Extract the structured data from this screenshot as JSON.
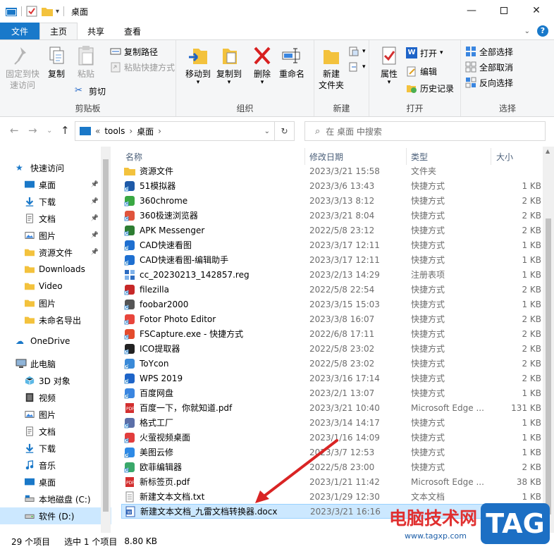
{
  "window": {
    "title": "桌面",
    "minimize_icon": "minimize-icon",
    "maximize_icon": "maximize-icon",
    "close_icon": "close-icon"
  },
  "ribbon_tabs": {
    "file": "文件",
    "home": "主页",
    "share": "共享",
    "view": "查看"
  },
  "ribbon": {
    "clipboard": {
      "label": "剪贴板",
      "pin_quick_line1": "固定到快",
      "pin_quick_line2": "速访问",
      "copy": "复制",
      "paste": "粘贴",
      "copy_path": "复制路径",
      "paste_shortcut": "粘贴快捷方式",
      "cut": "剪切"
    },
    "organize": {
      "label": "组织",
      "move_to": "移动到",
      "copy_to": "复制到",
      "delete": "删除",
      "rename": "重命名"
    },
    "new": {
      "label": "新建",
      "new_folder_line1": "新建",
      "new_folder_line2": "文件夹"
    },
    "open": {
      "label": "打开",
      "properties": "属性",
      "open": "打开",
      "edit": "编辑",
      "history": "历史记录"
    },
    "select": {
      "label": "选择",
      "select_all": "全部选择",
      "select_none": "全部取消",
      "invert": "反向选择"
    }
  },
  "address": {
    "prefix": "«",
    "crumb1": "tools",
    "sep1": "›",
    "crumb2": "桌面",
    "sep2": "›"
  },
  "search": {
    "placeholder": "在 桌面 中搜索"
  },
  "columns": {
    "name": "名称",
    "date": "修改日期",
    "type": "类型",
    "size": "大小"
  },
  "sidebar": {
    "quick_access": "快速访问",
    "items": [
      {
        "label": "桌面",
        "icon": "desktop-icon",
        "pinned": true
      },
      {
        "label": "下载",
        "icon": "download-icon",
        "pinned": true
      },
      {
        "label": "文档",
        "icon": "document-icon",
        "pinned": true
      },
      {
        "label": "图片",
        "icon": "picture-icon",
        "pinned": true
      },
      {
        "label": "资源文件",
        "icon": "folder-icon",
        "pinned": true
      },
      {
        "label": "Downloads",
        "icon": "folder-icon",
        "pinned": false
      },
      {
        "label": "Video",
        "icon": "folder-icon",
        "pinned": false
      },
      {
        "label": "图片",
        "icon": "folder-icon",
        "pinned": false
      },
      {
        "label": "未命名导出",
        "icon": "folder-icon",
        "pinned": false
      }
    ],
    "onedrive": "OneDrive",
    "this_pc": "此电脑",
    "pc_items": [
      {
        "label": "3D 对象",
        "icon": "3d-objects-icon"
      },
      {
        "label": "视频",
        "icon": "video-icon"
      },
      {
        "label": "图片",
        "icon": "picture-icon"
      },
      {
        "label": "文档",
        "icon": "document-icon"
      },
      {
        "label": "下载",
        "icon": "download-icon"
      },
      {
        "label": "音乐",
        "icon": "music-icon"
      },
      {
        "label": "桌面",
        "icon": "desktop-icon"
      },
      {
        "label": "本地磁盘 (C:)",
        "icon": "local-disk-icon"
      },
      {
        "label": "软件 (D:)",
        "icon": "drive-icon"
      }
    ]
  },
  "files": [
    {
      "name": "资源文件",
      "date": "2023/3/21 15:58",
      "type": "文件夹",
      "size": "",
      "color": "#f5c542",
      "icon": "folder-icon"
    },
    {
      "name": "51模拟器",
      "date": "2023/3/6 13:43",
      "type": "快捷方式",
      "size": "1 KB",
      "color": "#1e5aa8",
      "icon": "app-icon"
    },
    {
      "name": "360chrome",
      "date": "2023/3/13 8:12",
      "type": "快捷方式",
      "size": "2 KB",
      "color": "#3aa843",
      "icon": "browser-icon"
    },
    {
      "name": "360极速浏览器",
      "date": "2023/3/21 8:04",
      "type": "快捷方式",
      "size": "2 KB",
      "color": "#e0543c",
      "icon": "browser-icon"
    },
    {
      "name": "APK Messenger",
      "date": "2022/5/8 23:12",
      "type": "快捷方式",
      "size": "2 KB",
      "color": "#2e7d32",
      "icon": "app-icon"
    },
    {
      "name": "CAD快速看图",
      "date": "2023/3/17 12:11",
      "type": "快捷方式",
      "size": "1 KB",
      "color": "#1e6fd0",
      "icon": "app-icon"
    },
    {
      "name": "CAD快速看图-编辑助手",
      "date": "2023/3/17 12:11",
      "type": "快捷方式",
      "size": "1 KB",
      "color": "#1e6fd0",
      "icon": "app-icon"
    },
    {
      "name": "cc_20230213_142857.reg",
      "date": "2023/2/13 14:29",
      "type": "注册表项",
      "size": "1 KB",
      "color": "#2d6cc0",
      "icon": "registry-icon"
    },
    {
      "name": "filezilla",
      "date": "2022/5/8 22:54",
      "type": "快捷方式",
      "size": "2 KB",
      "color": "#c62828",
      "icon": "app-icon"
    },
    {
      "name": "foobar2000",
      "date": "2023/3/15 15:03",
      "type": "快捷方式",
      "size": "1 KB",
      "color": "#555555",
      "icon": "app-icon"
    },
    {
      "name": "Fotor Photo Editor",
      "date": "2023/3/8 16:07",
      "type": "快捷方式",
      "size": "2 KB",
      "color": "#e8453c",
      "icon": "app-icon"
    },
    {
      "name": "FSCapture.exe - 快捷方式",
      "date": "2022/6/8 17:11",
      "type": "快捷方式",
      "size": "2 KB",
      "color": "#e44b2c",
      "icon": "app-icon"
    },
    {
      "name": "ICO提取器",
      "date": "2022/5/8 23:02",
      "type": "快捷方式",
      "size": "2 KB",
      "color": "#222222",
      "icon": "app-icon"
    },
    {
      "name": "ToYcon",
      "date": "2022/5/8 23:02",
      "type": "快捷方式",
      "size": "2 KB",
      "color": "#3a8ad8",
      "icon": "app-icon"
    },
    {
      "name": "WPS 2019",
      "date": "2023/3/16 17:14",
      "type": "快捷方式",
      "size": "2 KB",
      "color": "#1e64c8",
      "icon": "app-icon"
    },
    {
      "name": "百度网盘",
      "date": "2023/2/1 13:07",
      "type": "快捷方式",
      "size": "1 KB",
      "color": "#3a86e0",
      "icon": "app-icon"
    },
    {
      "name": "百度一下，你就知道.pdf",
      "date": "2023/3/21 10:40",
      "type": "Microsoft Edge ...",
      "size": "131 KB",
      "color": "#d32f2f",
      "icon": "pdf-icon"
    },
    {
      "name": "格式工厂",
      "date": "2023/3/14 14:17",
      "type": "快捷方式",
      "size": "1 KB",
      "color": "#5b6fa8",
      "icon": "app-icon"
    },
    {
      "name": "火萤视频桌面",
      "date": "2023/1/16 14:09",
      "type": "快捷方式",
      "size": "1 KB",
      "color": "#e23d3d",
      "icon": "app-icon"
    },
    {
      "name": "美图云修",
      "date": "2023/3/7 12:53",
      "type": "快捷方式",
      "size": "1 KB",
      "color": "#2e8ae6",
      "icon": "app-icon"
    },
    {
      "name": "欧菲编辑器",
      "date": "2022/5/8 23:00",
      "type": "快捷方式",
      "size": "2 KB",
      "color": "#3aa86a",
      "icon": "app-icon"
    },
    {
      "name": "新标签页.pdf",
      "date": "2023/1/21 11:42",
      "type": "Microsoft Edge ...",
      "size": "38 KB",
      "color": "#d32f2f",
      "icon": "pdf-icon"
    },
    {
      "name": "新建文本文档.txt",
      "date": "2023/1/29 12:30",
      "type": "文本文档",
      "size": "1 KB",
      "color": "#9e9e9e",
      "icon": "text-file-icon"
    },
    {
      "name": "新建文本文档_九雷文档转换器.docx",
      "date": "2023/3/21 16:16",
      "type": "",
      "size": "",
      "color": "#2b5fb4",
      "icon": "word-doc-icon",
      "selected": true
    }
  ],
  "status": {
    "count": "29 个项目",
    "selected": "选中 1 个项目",
    "size": "8.80 KB"
  },
  "watermark": {
    "site_name": "电脑技术网",
    "url": "www.tagxp.com",
    "tag": "TAG"
  },
  "colors": {
    "accent": "#1979ca",
    "selection": "#cce8ff",
    "annotation_arrow": "#d92424"
  }
}
